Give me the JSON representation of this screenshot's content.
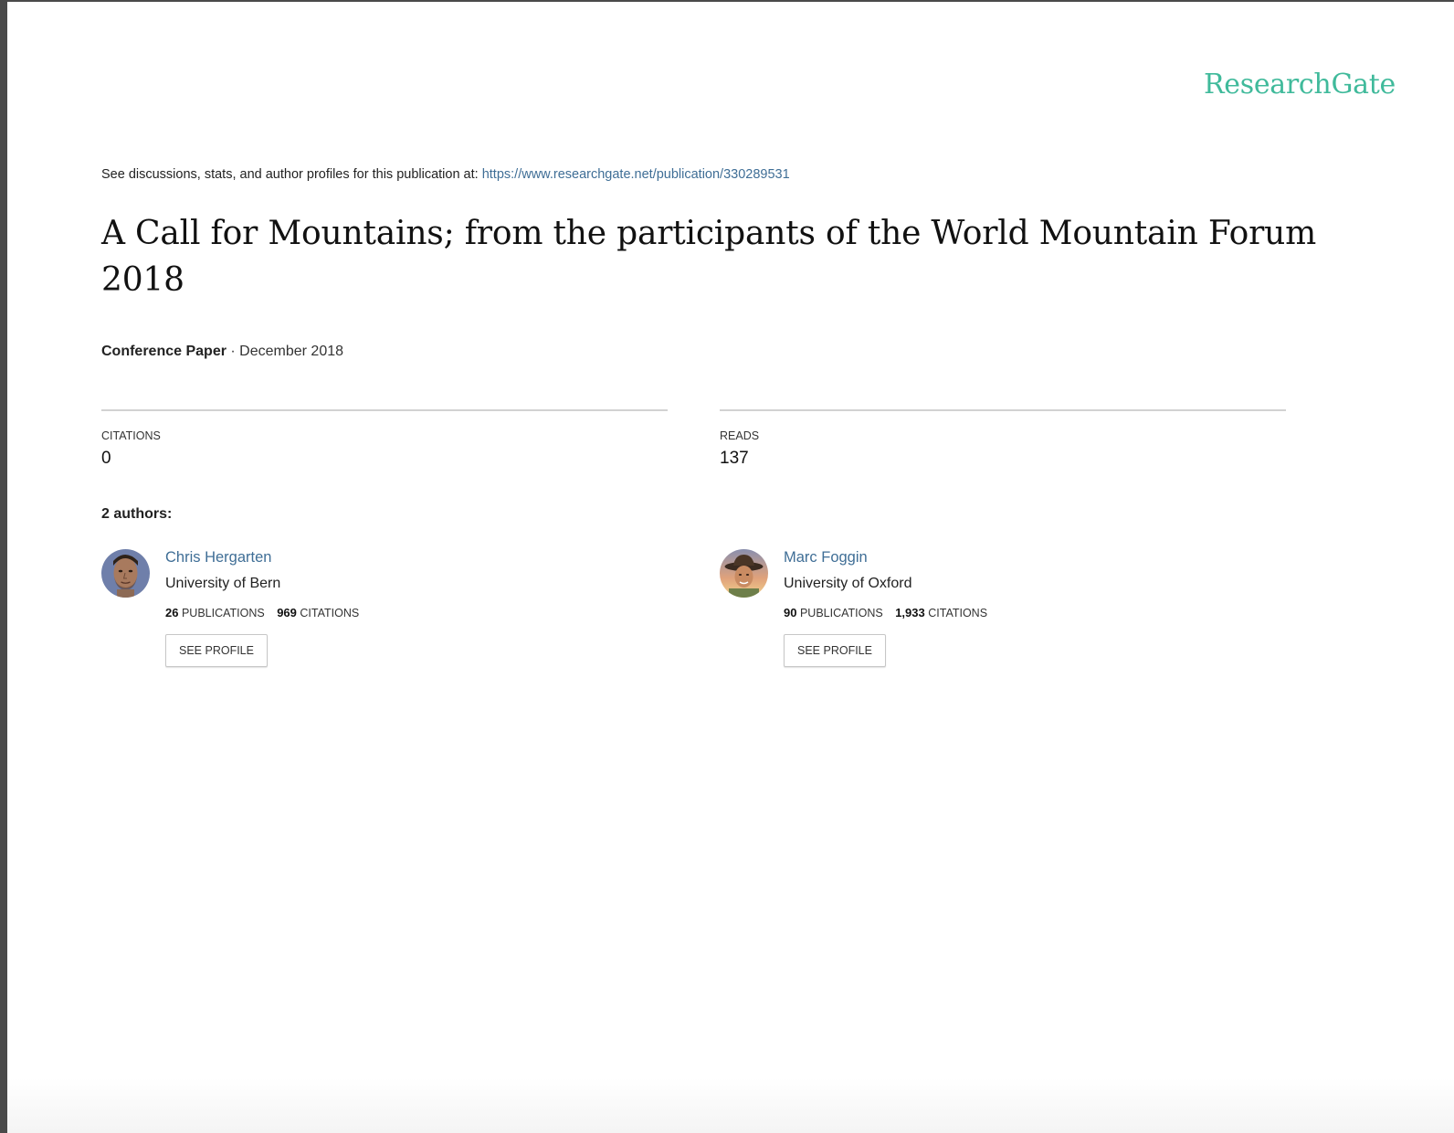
{
  "brand": {
    "name": "ResearchGate",
    "color": "#40ba9b"
  },
  "source": {
    "prefix": "See discussions, stats, and author profiles for this publication at:",
    "url": "https://www.researchgate.net/publication/330289531"
  },
  "publication": {
    "title": "A Call for Mountains; from the participants of the World Mountain Forum 2018",
    "type": "Conference Paper",
    "separator": "·",
    "date": "December 2018"
  },
  "stats": {
    "citations": {
      "label": "CITATIONS",
      "value": "0"
    },
    "reads": {
      "label": "READS",
      "value": "137"
    }
  },
  "authors_heading": "2 authors:",
  "authors": [
    {
      "name": "Chris Hergarten",
      "institution": "University of Bern",
      "publications_count": "26",
      "publications_label": "PUBLICATIONS",
      "citations_count": "969",
      "citations_label": "CITATIONS",
      "button_label": "SEE PROFILE"
    },
    {
      "name": "Marc Foggin",
      "institution": "University of Oxford",
      "publications_count": "90",
      "publications_label": "PUBLICATIONS",
      "citations_count": "1,933",
      "citations_label": "CITATIONS",
      "button_label": "SEE PROFILE"
    }
  ],
  "colors": {
    "link": "#3f6e96",
    "rule": "#d2d2d2",
    "text": "#222222"
  }
}
